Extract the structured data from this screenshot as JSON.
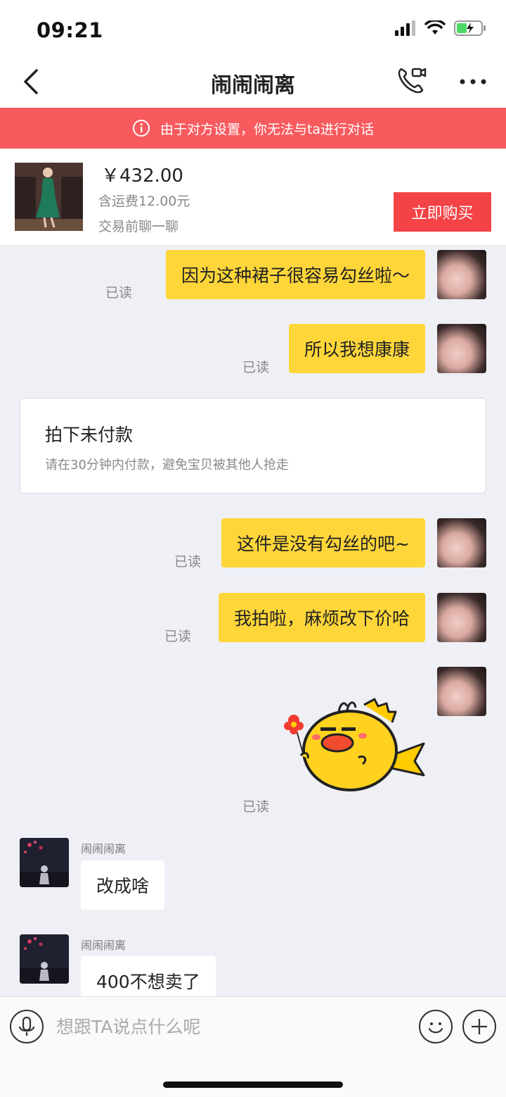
{
  "status_bar": {
    "time": "09:21"
  },
  "nav": {
    "title": "闹闹闹离",
    "back_icon": "chevron-left-icon",
    "call_icon": "phone-video-icon",
    "more_icon": "more-dots-icon"
  },
  "banner": {
    "text": "由于对方设置，你无法与ta进行对话",
    "icon": "info-icon",
    "color": "#f85a5e"
  },
  "product": {
    "price": "￥432.00",
    "shipping": "含运费12.00元",
    "chat_hint": "交易前聊一聊",
    "buy_label": "立即购买",
    "buy_color": "#f44346"
  },
  "messages": {
    "m1": {
      "text": "因为这种裙子很容易勾丝啦～",
      "read": "已读"
    },
    "m2": {
      "text": "所以我想康康",
      "read": "已读"
    },
    "order": {
      "title": "拍下未付款",
      "subtitle": "请在30分钟内付款，避免宝贝被其他人抢走"
    },
    "m3": {
      "text": "这件是没有勾丝的吧~",
      "read": "已读"
    },
    "m4": {
      "text": "我拍啦，麻烦改下价哈",
      "read": "已读"
    },
    "m5": {
      "sticker": "yellow-fish-sticker",
      "read": "已读"
    },
    "m6": {
      "sender": "闹闹闹离",
      "text": "改成啥"
    },
    "m7": {
      "sender": "闹闹闹离",
      "text": "400不想卖了"
    }
  },
  "input_bar": {
    "placeholder": "想跟TA说点什么呢",
    "mic_icon": "microphone-icon",
    "emoji_icon": "smiley-icon",
    "plus_icon": "plus-icon"
  },
  "colors": {
    "my_bubble": "#fed63a",
    "chat_bg": "#eef0f5"
  }
}
